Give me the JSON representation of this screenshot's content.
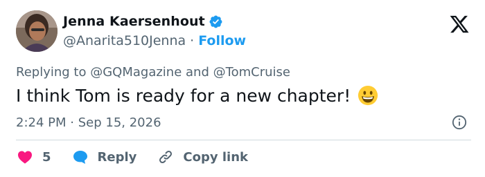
{
  "author": {
    "name": "Jenna Kaersenhout",
    "handle": "@Anarita510Jenna",
    "separator": "·",
    "follow_label": "Follow"
  },
  "tweet": {
    "replying_prefix": "Replying to",
    "replying_to": [
      "@GQMagazine",
      "@TomCruise"
    ],
    "replying_conj": "and",
    "text": "I think Tom is ready for a new chapter!",
    "emoji": "grinning-face",
    "time": "2:24 PM",
    "date_separator": "·",
    "date": "Sep 15, 2026"
  },
  "actions": {
    "like_count": "5",
    "reply_label": "Reply",
    "copy_link_label": "Copy link"
  },
  "colors": {
    "accent": "#1d9bf0",
    "like": "#f91880",
    "text": "#0f1419",
    "secondary": "#536471",
    "divider": "#cfd9de"
  }
}
